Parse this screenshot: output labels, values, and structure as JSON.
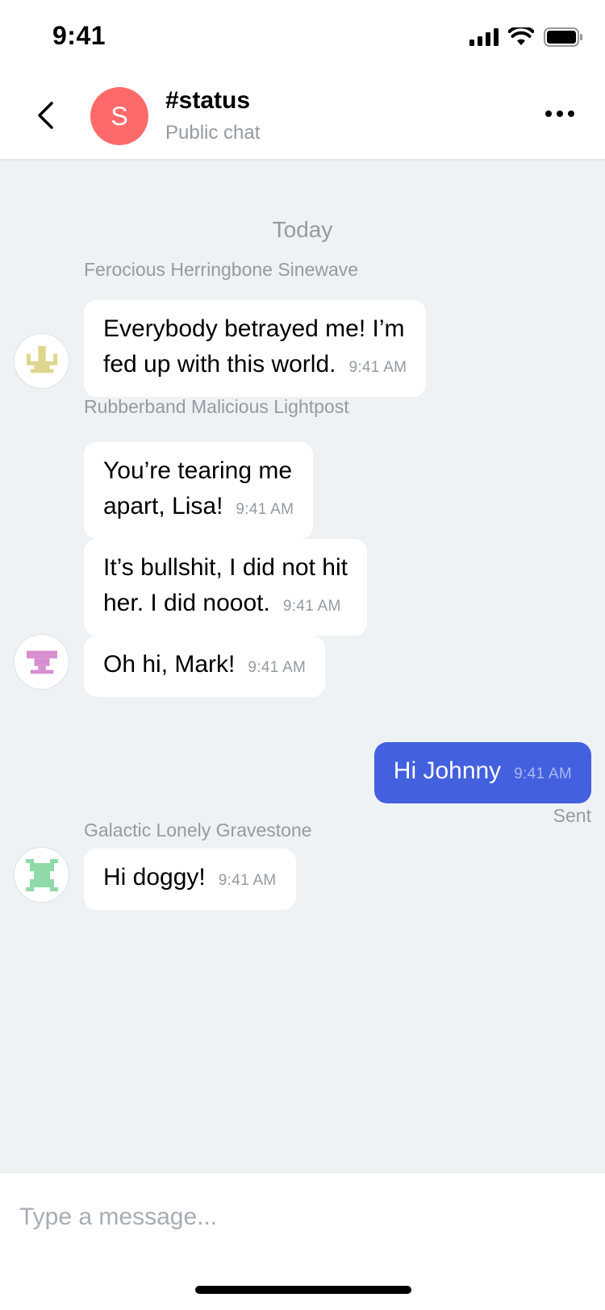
{
  "status_bar": {
    "time": "9:41"
  },
  "header": {
    "avatar_letter": "S",
    "title": "#status",
    "subtitle": "Public chat",
    "avatar_color": "#fe6a6a"
  },
  "messages": {
    "date_separator": "Today",
    "groups": [
      {
        "sender": "Ferocious Herringbone Sinewave",
        "avatar_icon": "yellow-pixel-identicon",
        "bubbles": [
          {
            "text": "Everybody betrayed me! I’m\nfed up with this world.",
            "time": "9:41 AM"
          }
        ]
      },
      {
        "sender": "Rubberband Malicious Lightpost",
        "avatar_icon": "pink-pixel-identicon",
        "bubbles": [
          {
            "text": "You’re tearing me\napart, Lisa!",
            "time": "9:41 AM"
          },
          {
            "text": "It’s bullshit, I did not hit\nher. I did nooot.",
            "time": "9:41 AM"
          },
          {
            "text": "Oh hi, Mark!",
            "time": "9:41 AM"
          }
        ]
      },
      {
        "outgoing": true,
        "bubbles": [
          {
            "text": "Hi Johnny",
            "time": "9:41 AM",
            "status": "Sent"
          }
        ]
      },
      {
        "sender": "Galactic Lonely Gravestone",
        "avatar_icon": "green-pixel-identicon",
        "bubbles": [
          {
            "text": "Hi doggy!",
            "time": "9:41 AM"
          }
        ]
      }
    ]
  },
  "composer": {
    "placeholder": "Type a message..."
  },
  "colors": {
    "accent": "#4360df",
    "secondary_text": "#939ba1",
    "chat_background": "#eef2f5"
  }
}
